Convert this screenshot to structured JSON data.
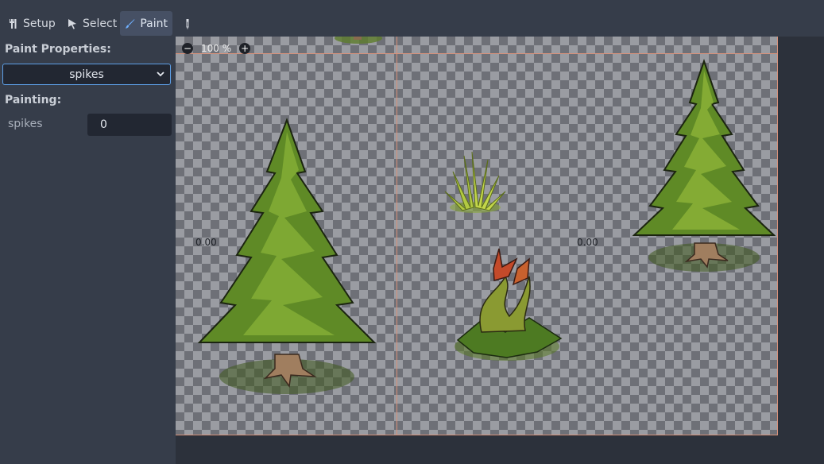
{
  "toolbar": {
    "setup_label": "Setup",
    "select_label": "Select",
    "paint_label": "Paint"
  },
  "left_panel": {
    "paint_properties_label": "Paint Properties:",
    "property_selected": "spikes",
    "painting_label": "Painting:",
    "painting_property_name": "spikes",
    "painting_property_value": "0"
  },
  "viewport": {
    "zoom_level": "100 %",
    "tile_labels": [
      "0.00",
      "0.00"
    ]
  },
  "colors": {
    "accent": "#5c9ee6",
    "grid_line": "#d7917a",
    "panel_bg": "#363d4a"
  }
}
